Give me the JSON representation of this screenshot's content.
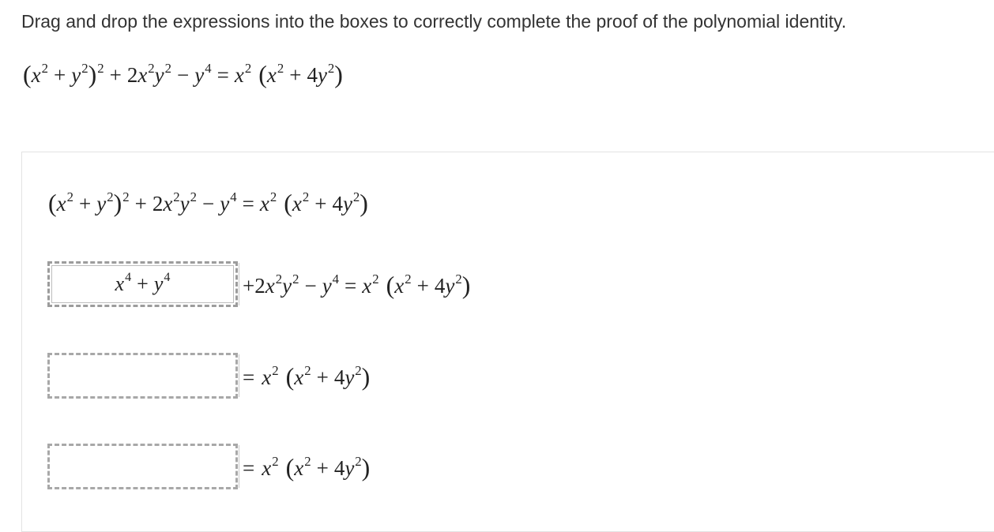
{
  "instructions": "Drag and drop the expressions into the boxes to correctly complete the proof of the polynomial identity.",
  "identity": {
    "lhs_base_x": "x",
    "lhs_base_y": "y",
    "middle_term": "2x²y²",
    "y4": "y⁴",
    "rhs": "x² (x² + 4y²)",
    "full_text": "(x² + y²)² + 2x²y² − y⁴ = x² (x² + 4y²)"
  },
  "proof_steps": [
    {
      "box_value": "x⁴ + y⁴",
      "filled": true,
      "tail": "+2x²y² − y⁴ = x² (x² + 4y²)"
    },
    {
      "box_value": "",
      "filled": false,
      "tail": "= x² (x² + 4y²)"
    },
    {
      "box_value": "",
      "filled": false,
      "tail": "= x² (x² + 4y²)"
    }
  ],
  "colors": {
    "text": "#222222",
    "instructions_text": "#333333",
    "dashed_border": "#a8a8a8",
    "panel_border": "#e3e3e3"
  }
}
